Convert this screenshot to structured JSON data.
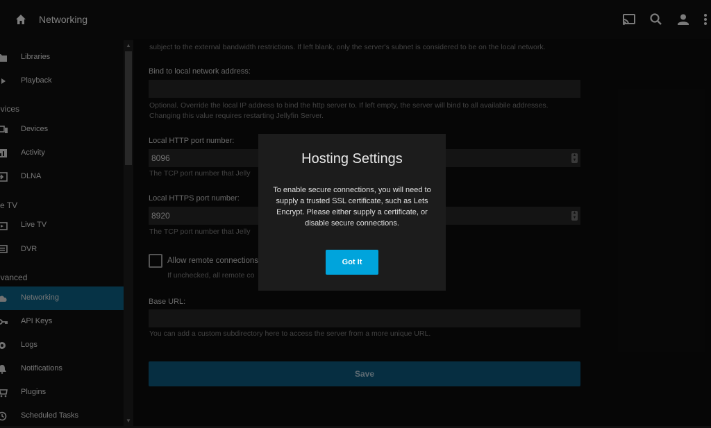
{
  "header": {
    "title": "Networking",
    "icons": [
      "home-icon",
      "cast-icon",
      "search-icon",
      "user-icon",
      "more-icon"
    ]
  },
  "sidebar": {
    "items": [
      {
        "label": "Libraries",
        "icon": "folder-icon"
      },
      {
        "label": "Playback",
        "icon": "play-icon"
      },
      {
        "label": "Devices",
        "icon": "devices-icon"
      },
      {
        "label": "Activity",
        "icon": "activity-icon"
      },
      {
        "label": "DLNA",
        "icon": "input-icon"
      },
      {
        "label": "Live TV",
        "icon": "live-tv-icon"
      },
      {
        "label": "DVR",
        "icon": "dvr-icon"
      },
      {
        "label": "Networking",
        "icon": "cloud-icon",
        "active": true
      },
      {
        "label": "API Keys",
        "icon": "key-icon"
      },
      {
        "label": "Logs",
        "icon": "logs-icon"
      },
      {
        "label": "Notifications",
        "icon": "bell-icon"
      },
      {
        "label": "Plugins",
        "icon": "cart-icon"
      },
      {
        "label": "Scheduled Tasks",
        "icon": "clock-icon"
      }
    ],
    "headers": [
      "evices",
      "ve TV",
      "dvanced"
    ]
  },
  "form": {
    "top_help": "subject to the external bandwidth restrictions. If left blank, only the server's subnet is considered to be on the local network.",
    "bind_label": "Bind to local network address:",
    "bind_value": "",
    "bind_help": "Optional. Override the local IP address to bind the http server to. If left empty, the server will bind to all availabile addresses. Changing this value requires restarting Jellyfin Server.",
    "http_label": "Local HTTP port number:",
    "http_value": "8096",
    "http_help": "The TCP port number that Jelly",
    "https_label": "Local HTTPS port number:",
    "https_value": "8920",
    "https_help": "The TCP port number that Jelly",
    "remote_label": "Allow remote connections",
    "remote_help": "If unchecked, all remote co",
    "baseurl_label": "Base URL:",
    "baseurl_value": "",
    "baseurl_help": "You can add a custom subdirectory here to access the server from a more unique URL.",
    "save_label": "Save"
  },
  "dialog": {
    "title": "Hosting Settings",
    "body": "To enable secure connections, you will need to supply a trusted SSL certificate, such as Lets Encrypt. Please either supply a certificate, or disable secure connections.",
    "button": "Got It"
  },
  "colors": {
    "accent": "#00a4dc",
    "active_nav": "#0b5d80",
    "save_button": "#0b5577",
    "background": "#101010"
  }
}
